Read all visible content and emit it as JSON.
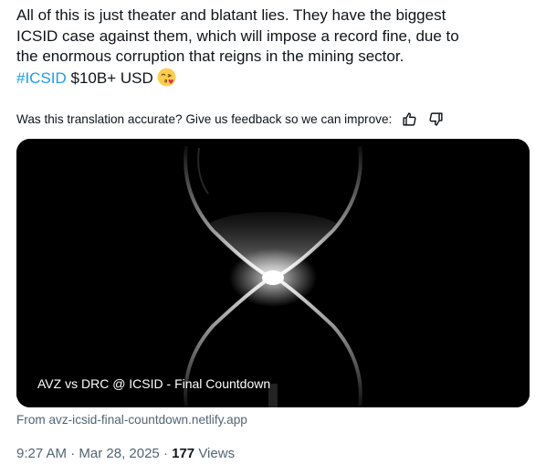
{
  "tweet": {
    "text_line1": "All of this is just theater and blatant lies. They have the biggest",
    "text_line2": "ICSID case against them, which will impose a record fine, due to",
    "text_line3": "the enormous corruption that reigns in the mining sector.",
    "hashtag": "#ICSID",
    "amount": " $10B+ USD",
    "emoji": "face-blowing-kiss-icon"
  },
  "feedback": {
    "prompt": "Was this translation accurate? Give us feedback so we can improve:",
    "thumbs_up": "thumbs-up-icon",
    "thumbs_down": "thumbs-down-icon"
  },
  "card": {
    "title": "AVZ vs DRC @ ICSID - Final Countdown",
    "image": "hourglass-image",
    "source": "From avz-icsid-final-countdown.netlify.app"
  },
  "meta": {
    "time": "9:27 AM",
    "sep1": " · ",
    "date": "Mar 28, 2025",
    "sep2": " · ",
    "views_count": "177",
    "views_label": " Views"
  },
  "colors": {
    "text": "#0f1419",
    "secondary": "#536471",
    "link": "#1d9bf0",
    "card_bg": "#000000"
  }
}
